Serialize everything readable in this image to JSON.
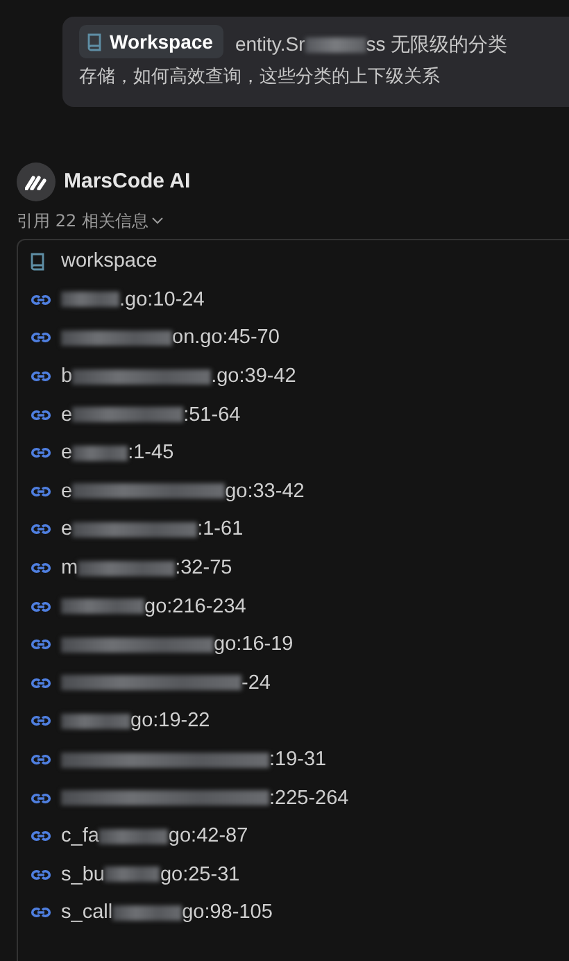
{
  "user_message": {
    "chip": "Workspace",
    "text": "entity.Sr",
    "text_after": "ss 无限级的分类",
    "line2": "存储，如何高效查询，这些分类的上下级关系"
  },
  "assistant": {
    "name": "MarsCode AI",
    "references_toggle": "引用 22 相关信息",
    "expanded": true,
    "references": [
      {
        "kind": "folder",
        "label": "workspace"
      },
      {
        "kind": "file",
        "end": ".go:10-24"
      },
      {
        "kind": "file",
        "end": "on.go:45-70"
      },
      {
        "kind": "file",
        "start": "b",
        "end": ".go:39-42"
      },
      {
        "kind": "file",
        "start": "e",
        "end": ":51-64"
      },
      {
        "kind": "file",
        "start": "e",
        "end": ":1-45"
      },
      {
        "kind": "file",
        "start": "e",
        "end": "go:33-42"
      },
      {
        "kind": "file",
        "start": "e",
        "end": ":1-61"
      },
      {
        "kind": "file",
        "start": "m",
        "end": ":32-75"
      },
      {
        "kind": "file",
        "end": "go:216-234"
      },
      {
        "kind": "file",
        "end": "go:16-19"
      },
      {
        "kind": "file",
        "end": "-24"
      },
      {
        "kind": "file",
        "end": "go:19-22"
      },
      {
        "kind": "file",
        "end": ":19-31"
      },
      {
        "kind": "file",
        "end": ":225-264"
      },
      {
        "kind": "file",
        "start": "c_fa",
        "end": "go:42-87"
      },
      {
        "kind": "file",
        "start": "s_bu",
        "end": "go:25-31"
      },
      {
        "kind": "file",
        "start": "s_call",
        "end": "go:98-105"
      }
    ]
  }
}
